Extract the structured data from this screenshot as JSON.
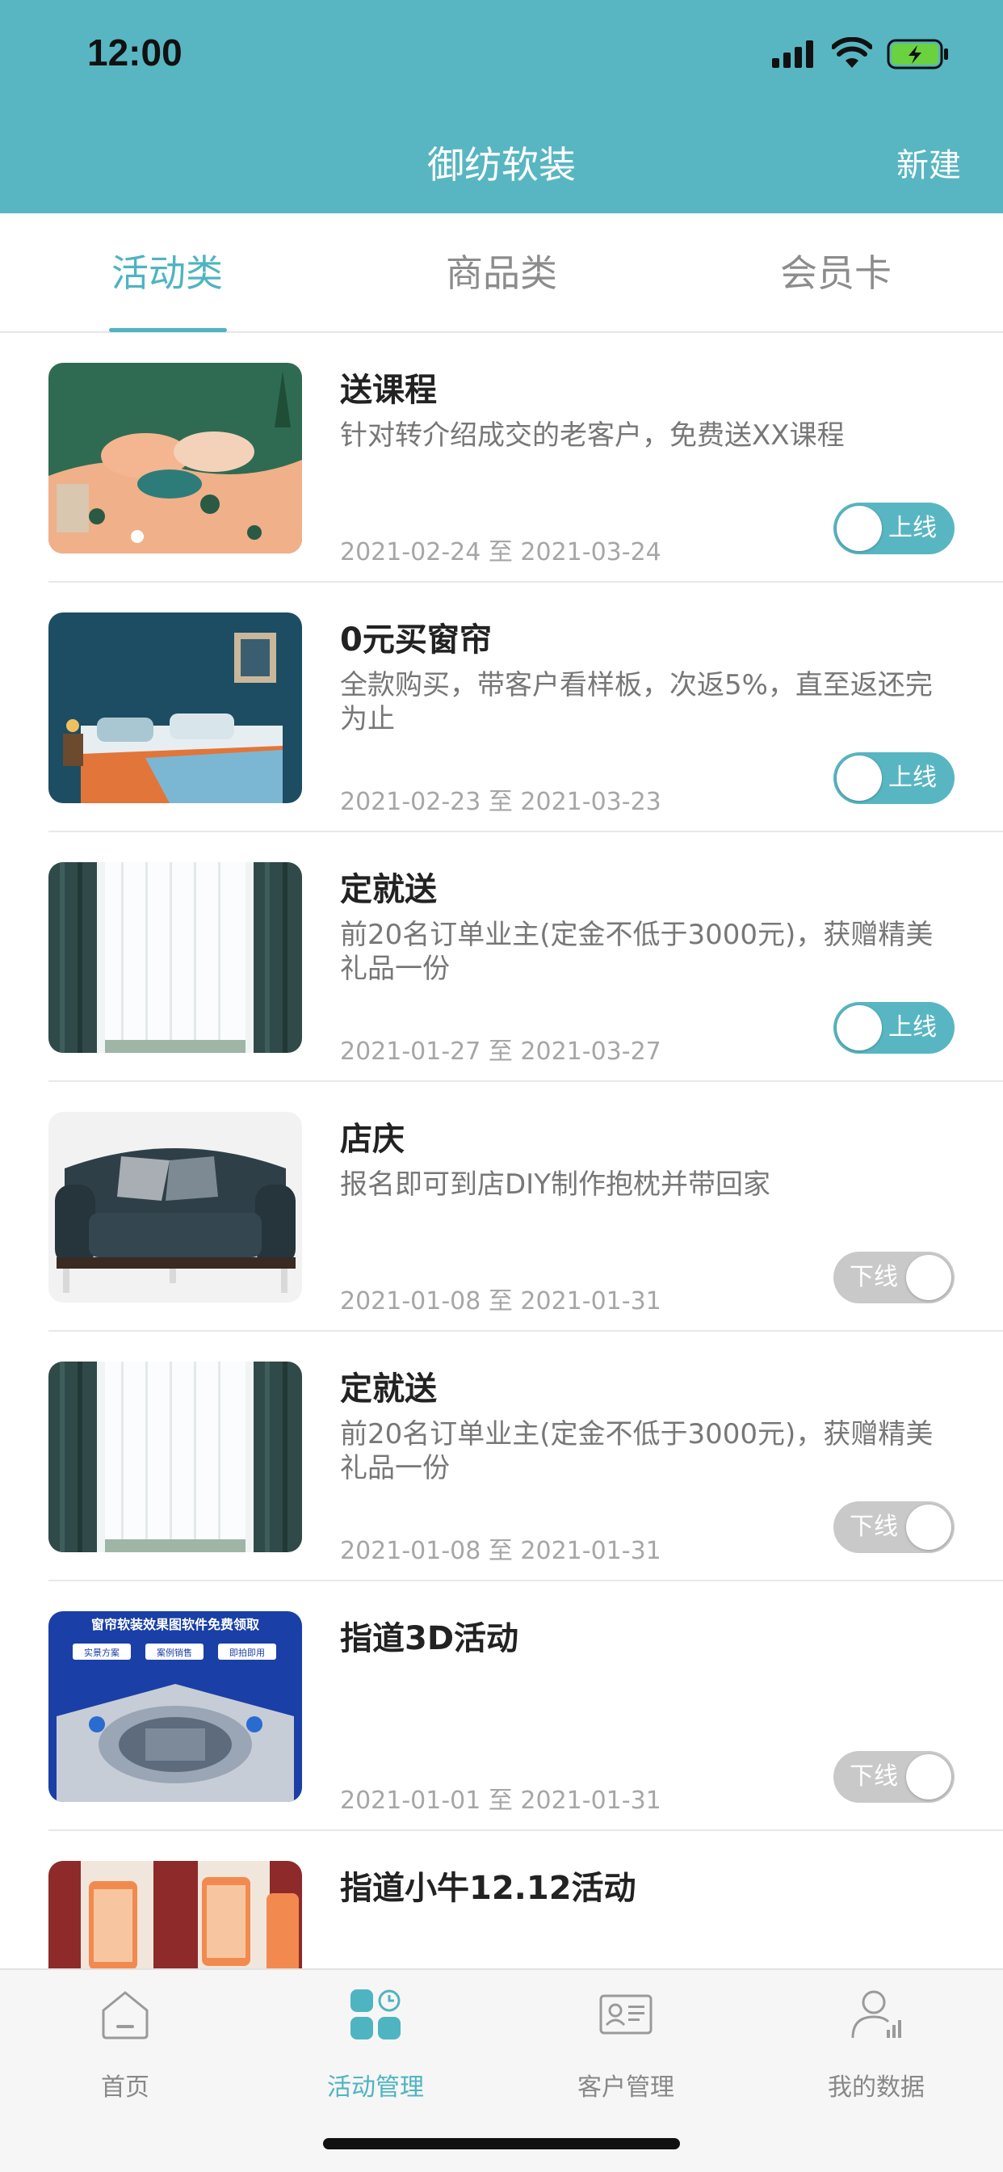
{
  "status": {
    "time": "12:00"
  },
  "nav": {
    "title": "御纺软装",
    "new_label": "新建"
  },
  "tabs": [
    {
      "label": "活动类",
      "active": true
    },
    {
      "label": "商品类",
      "active": false
    },
    {
      "label": "会员卡",
      "active": false
    }
  ],
  "items": [
    {
      "title": "送课程",
      "desc": "针对转介绍成交的老客户，免费送XX课程",
      "date": "2021-02-24 至 2021-03-24",
      "status": "上线",
      "online": true,
      "image": "bedding-peach"
    },
    {
      "title": "0元买窗帘",
      "desc": "全款购买，带客户看样板，次返5%，直至返还完为止",
      "date": "2021-02-23 至 2021-03-23",
      "status": "上线",
      "online": true,
      "image": "bedroom-teal"
    },
    {
      "title": "定就送",
      "desc": "前20名订单业主(定金不低于3000元)，获赠精美礼品一份",
      "date": "2021-01-27 至 2021-03-27",
      "status": "上线",
      "online": true,
      "image": "curtain"
    },
    {
      "title": "店庆",
      "desc": "报名即可到店DIY制作抱枕并带回家",
      "date": "2021-01-08 至 2021-01-31",
      "status": "下线",
      "online": false,
      "image": "sofa"
    },
    {
      "title": "定就送",
      "desc": "前20名订单业主(定金不低于3000元)，获赠精美礼品一份",
      "date": "2021-01-08 至 2021-01-31",
      "status": "下线",
      "online": false,
      "image": "curtain"
    },
    {
      "title": "指道3D活动",
      "desc": "",
      "date": "2021-01-01 至 2021-01-31",
      "status": "下线",
      "online": false,
      "image": "software-promo",
      "image_text": {
        "headline": "窗帘软装效果图软件免费领取",
        "tags": [
          "实景方案",
          "案例销售",
          "即拍即用"
        ]
      }
    },
    {
      "title": "指道小牛12.12活动",
      "desc": "",
      "date": "",
      "status": "",
      "online": false,
      "image": "phones-red"
    }
  ],
  "tabbar": [
    {
      "label": "首页",
      "icon": "home-icon",
      "active": false
    },
    {
      "label": "活动管理",
      "icon": "activity-grid-icon",
      "active": true
    },
    {
      "label": "客户管理",
      "icon": "customer-card-icon",
      "active": false
    },
    {
      "label": "我的数据",
      "icon": "user-data-icon",
      "active": false
    }
  ],
  "colors": {
    "accent": "#58b6c2",
    "tab_active": "#4fb4c1",
    "toggle_off": "#c9c9c9"
  }
}
